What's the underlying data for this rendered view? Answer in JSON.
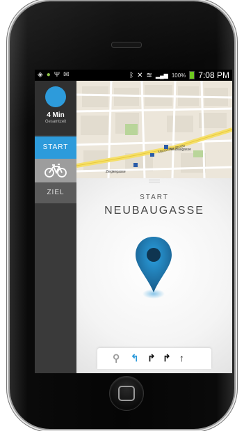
{
  "status_bar": {
    "left_icons": [
      "location-icon",
      "android-icon",
      "usb-icon",
      "message-icon"
    ],
    "right_icons": [
      "bluetooth-icon",
      "mute-icon",
      "wifi-icon",
      "signal-icon"
    ],
    "battery_text": "100%",
    "time": "7:08 PM",
    "colors": {
      "battery": "#6ec91f"
    }
  },
  "sidebar": {
    "timer": {
      "value": "4 Min",
      "subtitle": "Gesamtzeit",
      "color": "#2d9bdb"
    },
    "items": [
      {
        "label": "START",
        "active": true
      },
      {
        "label": "",
        "icon": "bicycle-icon"
      },
      {
        "label": "ZIEL"
      }
    ]
  },
  "map": {
    "labels": {
      "main_road": "Mariahilfer Straße",
      "station_1": "Zieglergasse",
      "station_2": "Neubaugasse"
    }
  },
  "main": {
    "start_label": "START",
    "destination": "NEUBAUGASSE",
    "pin_icon": "location-pin-icon",
    "accent": "#2d9bdb"
  },
  "route_steps": [
    {
      "icon": "marker-step-icon",
      "glyph": "⚲"
    },
    {
      "icon": "turn-left-icon",
      "glyph": "↰",
      "active": true
    },
    {
      "icon": "turn-right-icon",
      "glyph": "↱"
    },
    {
      "icon": "turn-right-icon",
      "glyph": "↱"
    },
    {
      "icon": "straight-icon",
      "glyph": "↑"
    }
  ]
}
